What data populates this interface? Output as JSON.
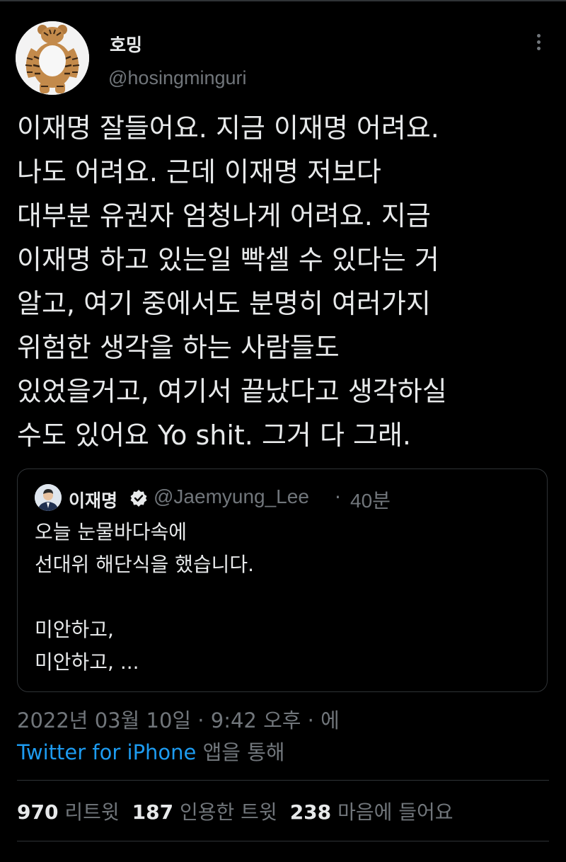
{
  "author": {
    "display_name": "호밍",
    "handle": "@hosingminguri",
    "avatar_icon": "tiger-mascot-avatar"
  },
  "tweet": {
    "lines": [
      "이재명 잘들어요. 지금 이재명 어려요.",
      "나도 어려요. 근데 이재명 저보다",
      "대부분 유권자 엄청나게 어려요. 지금",
      "이재명 하고 있는일 빡셀 수 있다는 거",
      "알고, 여기 중에서도 분명히 여러가지",
      "위험한 생각을 하는 사람들도",
      "있었을거고, 여기서 끝났다고 생각하실",
      "수도 있어요 Yo shit. 그거 다 그래."
    ]
  },
  "quoted_tweet": {
    "display_name": "이재명",
    "verified_icon": "verified-badge-icon",
    "handle": "@Jaemyung_Lee",
    "separator": "·",
    "time": "40분",
    "lines": [
      "오늘 눈물바다속에",
      "선대위 해단식을 했습니다.",
      "",
      "미안하고,",
      "미안하고, ..."
    ]
  },
  "meta": {
    "date_line": "2022년 03월 10일 · 9:42 오후 · 에",
    "source_link": "Twitter for iPhone",
    "source_suffix": " 앱을 통해"
  },
  "stats": {
    "retweets_count": "970",
    "retweets_label": "리트윗",
    "quotes_count": "187",
    "quotes_label": "인용한 트윗",
    "likes_count": "238",
    "likes_label": "마음에 들어요"
  },
  "colors": {
    "background": "#000000",
    "text": "#e7e9ea",
    "muted": "#71767b",
    "link": "#1d9bf0",
    "border": "#2f3336"
  }
}
